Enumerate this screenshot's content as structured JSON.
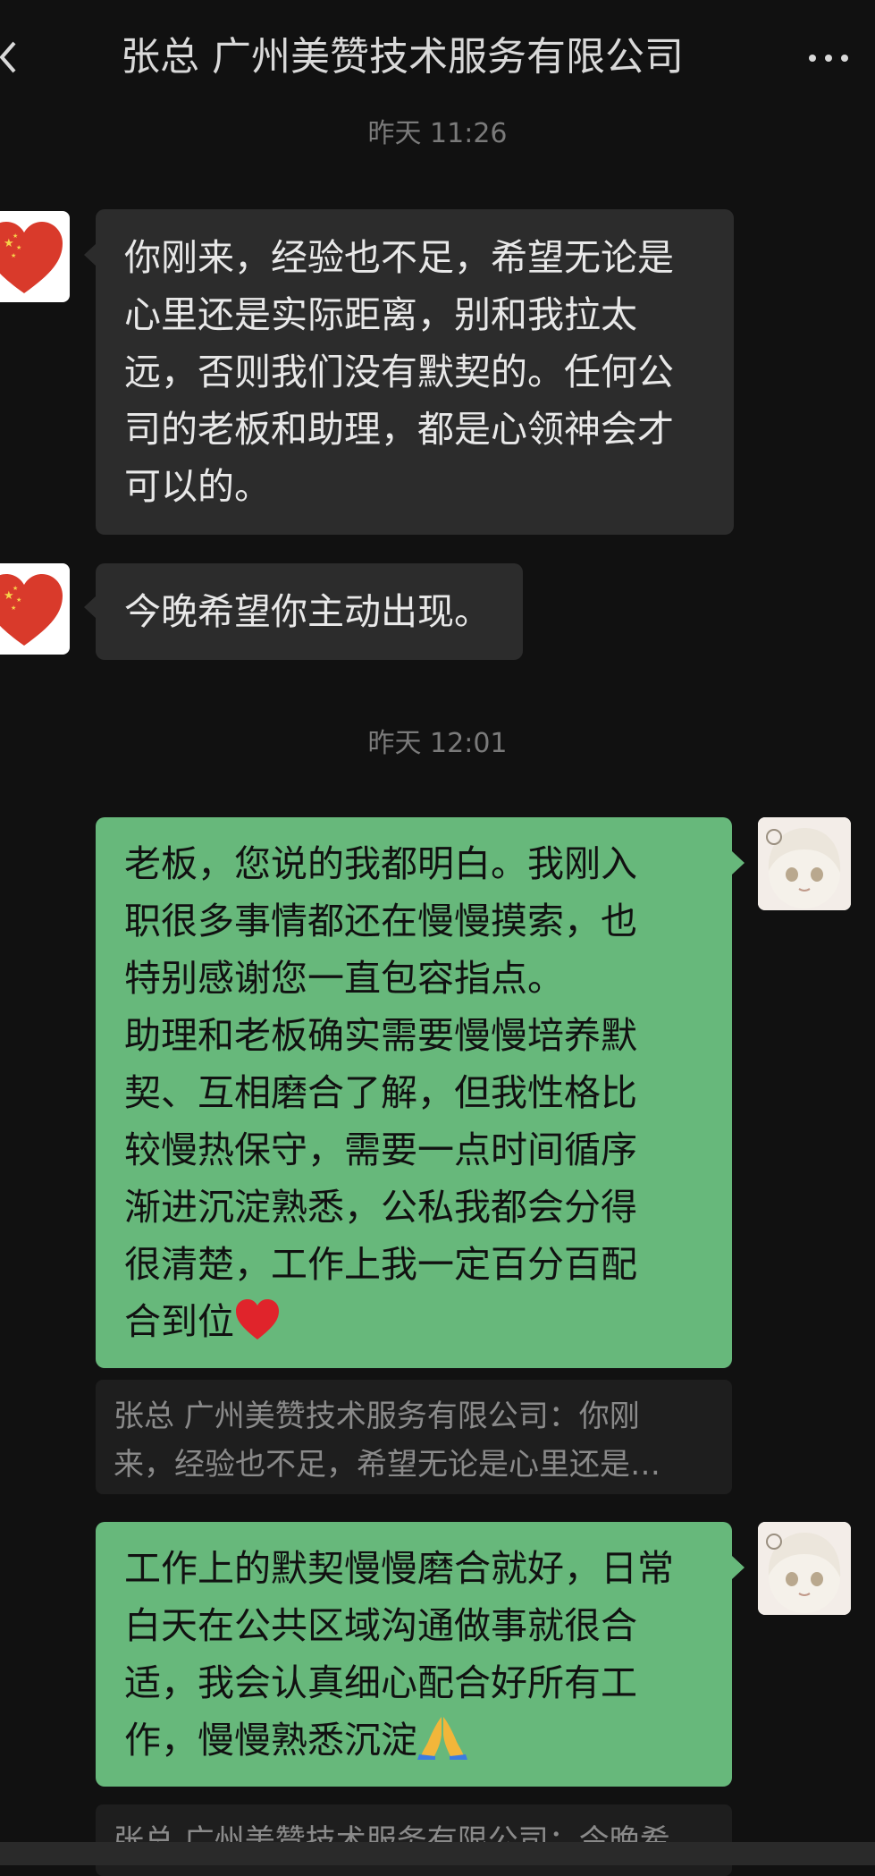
{
  "header": {
    "title": "张总 广州美赞技术服务有限公司",
    "back_icon": "chevron-left-icon",
    "more_icon": "ellipsis-icon"
  },
  "messages": {
    "time1": "昨天 11:26",
    "in1": "你刚来，经验也不足，希望无论是\n心里还是实际距离，别和我拉太\n远，否则我们没有默契的。任何公\n司的老板和助理，都是心领神会才\n可以的。",
    "in2": "今晚希望你主动出现。",
    "time2": "昨天 12:01",
    "out1": "老板，您说的我都明白。我刚入\n职很多事情都还在慢慢摸索，也\n特别感谢您一直包容指点。\n助理和老板确实需要慢慢培养默\n契、互相磨合了解，但我性格比\n较慢热保守，需要一点时间循序\n渐进沉淀熟悉，公私我都会分得\n很清楚，工作上我一定百分百配\n合到位",
    "quote1_line1": "张总 广州美赞技术服务有限公司：你刚",
    "quote1_line2": "来，经验也不足，希望无论是心里还是…",
    "out2": "工作上的默契慢慢磨合就好，日常\n白天在公共区域沟通做事就很合\n适，我会认真细心配合好所有工\n作，慢慢熟悉沉淀",
    "quote2_line1": "张总 广州美赞技术服务有限公司：今晚希"
  },
  "colors": {
    "background": "#111111",
    "incoming_bubble": "#2c2c2c",
    "outgoing_bubble": "#67b87b",
    "heart": "#d93a2b"
  }
}
